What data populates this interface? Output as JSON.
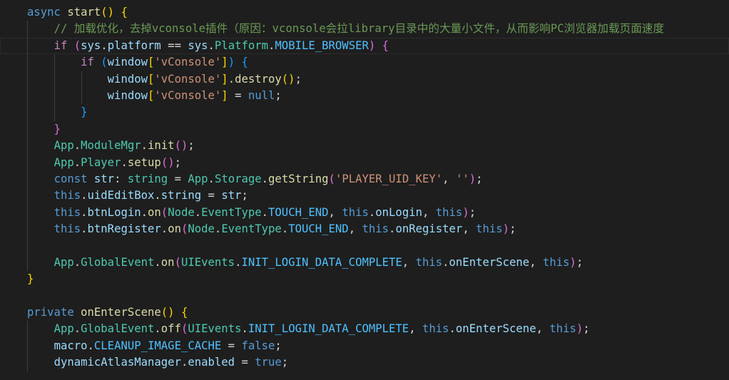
{
  "editor": {
    "colors": {
      "background": "#1e1e1e",
      "keyword": "#569cd6",
      "control": "#c586c0",
      "function": "#dcdcaa",
      "variable": "#9cdcfe",
      "class": "#4ec9b0",
      "string": "#ce9178",
      "comment": "#6a9955",
      "constant": "#4fc1ff",
      "punct": "#d4d4d4",
      "bracket1": "#ffd700",
      "bracket2": "#da70d6",
      "bracket3": "#179fff"
    },
    "lines": [
      {
        "indent": 0,
        "tokens": [
          [
            "async ",
            "keyword"
          ],
          [
            "start",
            "function"
          ],
          [
            "() ",
            "bracket1"
          ],
          [
            "{",
            "bracket1"
          ]
        ]
      },
      {
        "indent": 1,
        "tokens": [
          [
            "// 加载优化，去掉vconsole插件（原因：vconsole会拉library目录中的大量小文件，从而影响PC浏览器加载页面速度",
            "comment"
          ]
        ]
      },
      {
        "indent": 1,
        "current": true,
        "tokens": [
          [
            "if ",
            "control"
          ],
          [
            "(",
            "bracket2"
          ],
          [
            "sys",
            "variable"
          ],
          [
            ".",
            "punct"
          ],
          [
            "platform",
            "variable"
          ],
          [
            " == ",
            "punct"
          ],
          [
            "sys",
            "variable"
          ],
          [
            ".",
            "punct"
          ],
          [
            "Platform",
            "class"
          ],
          [
            ".",
            "punct"
          ],
          [
            "MOBILE_BROWSER",
            "constant"
          ],
          [
            ") ",
            "bracket2"
          ],
          [
            "{",
            "bracket2"
          ]
        ]
      },
      {
        "indent": 2,
        "tokens": [
          [
            "if ",
            "control"
          ],
          [
            "(",
            "bracket3"
          ],
          [
            "window",
            "variable"
          ],
          [
            "[",
            "bracket1"
          ],
          [
            "'vConsole'",
            "string"
          ],
          [
            "]",
            "bracket1"
          ],
          [
            ") ",
            "bracket3"
          ],
          [
            "{",
            "bracket3"
          ]
        ]
      },
      {
        "indent": 3,
        "tokens": [
          [
            "window",
            "variable"
          ],
          [
            "[",
            "bracket1"
          ],
          [
            "'vConsole'",
            "string"
          ],
          [
            "]",
            "bracket1"
          ],
          [
            ".",
            "punct"
          ],
          [
            "destroy",
            "function"
          ],
          [
            "()",
            "bracket1"
          ],
          [
            ";",
            "punct"
          ]
        ]
      },
      {
        "indent": 3,
        "tokens": [
          [
            "window",
            "variable"
          ],
          [
            "[",
            "bracket1"
          ],
          [
            "'vConsole'",
            "string"
          ],
          [
            "]",
            "bracket1"
          ],
          [
            " = ",
            "punct"
          ],
          [
            "null",
            "keyword"
          ],
          [
            ";",
            "punct"
          ]
        ]
      },
      {
        "indent": 2,
        "tokens": [
          [
            "}",
            "bracket3"
          ]
        ]
      },
      {
        "indent": 1,
        "tokens": [
          [
            "}",
            "bracket2"
          ]
        ]
      },
      {
        "indent": 1,
        "tokens": [
          [
            "App",
            "class"
          ],
          [
            ".",
            "punct"
          ],
          [
            "ModuleMgr",
            "class"
          ],
          [
            ".",
            "punct"
          ],
          [
            "init",
            "function"
          ],
          [
            "()",
            "bracket2"
          ],
          [
            ";",
            "punct"
          ]
        ]
      },
      {
        "indent": 1,
        "tokens": [
          [
            "App",
            "class"
          ],
          [
            ".",
            "punct"
          ],
          [
            "Player",
            "class"
          ],
          [
            ".",
            "punct"
          ],
          [
            "setup",
            "function"
          ],
          [
            "()",
            "bracket2"
          ],
          [
            ";",
            "punct"
          ]
        ]
      },
      {
        "indent": 1,
        "tokens": [
          [
            "const ",
            "keyword"
          ],
          [
            "str",
            "variable"
          ],
          [
            ": ",
            "punct"
          ],
          [
            "string",
            "class"
          ],
          [
            " = ",
            "punct"
          ],
          [
            "App",
            "class"
          ],
          [
            ".",
            "punct"
          ],
          [
            "Storage",
            "class"
          ],
          [
            ".",
            "punct"
          ],
          [
            "getString",
            "function"
          ],
          [
            "(",
            "bracket2"
          ],
          [
            "'PLAYER_UID_KEY'",
            "string"
          ],
          [
            ", ",
            "punct"
          ],
          [
            "''",
            "string"
          ],
          [
            ")",
            "bracket2"
          ],
          [
            ";",
            "punct"
          ]
        ]
      },
      {
        "indent": 1,
        "tokens": [
          [
            "this",
            "keyword"
          ],
          [
            ".",
            "punct"
          ],
          [
            "uidEditBox",
            "variable"
          ],
          [
            ".",
            "punct"
          ],
          [
            "string",
            "variable"
          ],
          [
            " = ",
            "punct"
          ],
          [
            "str",
            "variable"
          ],
          [
            ";",
            "punct"
          ]
        ]
      },
      {
        "indent": 1,
        "tokens": [
          [
            "this",
            "keyword"
          ],
          [
            ".",
            "punct"
          ],
          [
            "btnLogin",
            "variable"
          ],
          [
            ".",
            "punct"
          ],
          [
            "on",
            "function"
          ],
          [
            "(",
            "bracket2"
          ],
          [
            "Node",
            "class"
          ],
          [
            ".",
            "punct"
          ],
          [
            "EventType",
            "class"
          ],
          [
            ".",
            "punct"
          ],
          [
            "TOUCH_END",
            "constant"
          ],
          [
            ", ",
            "punct"
          ],
          [
            "this",
            "keyword"
          ],
          [
            ".",
            "punct"
          ],
          [
            "onLogin",
            "variable"
          ],
          [
            ", ",
            "punct"
          ],
          [
            "this",
            "keyword"
          ],
          [
            ")",
            "bracket2"
          ],
          [
            ";",
            "punct"
          ]
        ]
      },
      {
        "indent": 1,
        "tokens": [
          [
            "this",
            "keyword"
          ],
          [
            ".",
            "punct"
          ],
          [
            "btnRegister",
            "variable"
          ],
          [
            ".",
            "punct"
          ],
          [
            "on",
            "function"
          ],
          [
            "(",
            "bracket2"
          ],
          [
            "Node",
            "class"
          ],
          [
            ".",
            "punct"
          ],
          [
            "EventType",
            "class"
          ],
          [
            ".",
            "punct"
          ],
          [
            "TOUCH_END",
            "constant"
          ],
          [
            ", ",
            "punct"
          ],
          [
            "this",
            "keyword"
          ],
          [
            ".",
            "punct"
          ],
          [
            "onRegister",
            "variable"
          ],
          [
            ", ",
            "punct"
          ],
          [
            "this",
            "keyword"
          ],
          [
            ")",
            "bracket2"
          ],
          [
            ";",
            "punct"
          ]
        ]
      },
      {
        "indent": 1,
        "tokens": []
      },
      {
        "indent": 1,
        "tokens": [
          [
            "App",
            "class"
          ],
          [
            ".",
            "punct"
          ],
          [
            "GlobalEvent",
            "class"
          ],
          [
            ".",
            "punct"
          ],
          [
            "on",
            "function"
          ],
          [
            "(",
            "bracket2"
          ],
          [
            "UIEvents",
            "class"
          ],
          [
            ".",
            "punct"
          ],
          [
            "INIT_LOGIN_DATA_COMPLETE",
            "constant"
          ],
          [
            ", ",
            "punct"
          ],
          [
            "this",
            "keyword"
          ],
          [
            ".",
            "punct"
          ],
          [
            "onEnterScene",
            "variable"
          ],
          [
            ", ",
            "punct"
          ],
          [
            "this",
            "keyword"
          ],
          [
            ")",
            "bracket2"
          ],
          [
            ";",
            "punct"
          ]
        ]
      },
      {
        "indent": 0,
        "tokens": [
          [
            "}",
            "bracket1"
          ]
        ]
      },
      {
        "indent": 0,
        "tokens": []
      },
      {
        "indent": 0,
        "tokens": [
          [
            "private ",
            "keyword"
          ],
          [
            "onEnterScene",
            "function"
          ],
          [
            "() ",
            "bracket1"
          ],
          [
            "{",
            "bracket1"
          ]
        ]
      },
      {
        "indent": 1,
        "tokens": [
          [
            "App",
            "class"
          ],
          [
            ".",
            "punct"
          ],
          [
            "GlobalEvent",
            "class"
          ],
          [
            ".",
            "punct"
          ],
          [
            "off",
            "function"
          ],
          [
            "(",
            "bracket2"
          ],
          [
            "UIEvents",
            "class"
          ],
          [
            ".",
            "punct"
          ],
          [
            "INIT_LOGIN_DATA_COMPLETE",
            "constant"
          ],
          [
            ", ",
            "punct"
          ],
          [
            "this",
            "keyword"
          ],
          [
            ".",
            "punct"
          ],
          [
            "onEnterScene",
            "variable"
          ],
          [
            ", ",
            "punct"
          ],
          [
            "this",
            "keyword"
          ],
          [
            ")",
            "bracket2"
          ],
          [
            ";",
            "punct"
          ]
        ]
      },
      {
        "indent": 1,
        "tokens": [
          [
            "macro",
            "variable"
          ],
          [
            ".",
            "punct"
          ],
          [
            "CLEANUP_IMAGE_CACHE",
            "constant"
          ],
          [
            " = ",
            "punct"
          ],
          [
            "false",
            "keyword"
          ],
          [
            ";",
            "punct"
          ]
        ]
      },
      {
        "indent": 1,
        "tokens": [
          [
            "dynamicAtlasManager",
            "variable"
          ],
          [
            ".",
            "punct"
          ],
          [
            "enabled",
            "variable"
          ],
          [
            " = ",
            "punct"
          ],
          [
            "true",
            "keyword"
          ],
          [
            ";",
            "punct"
          ]
        ]
      }
    ]
  }
}
